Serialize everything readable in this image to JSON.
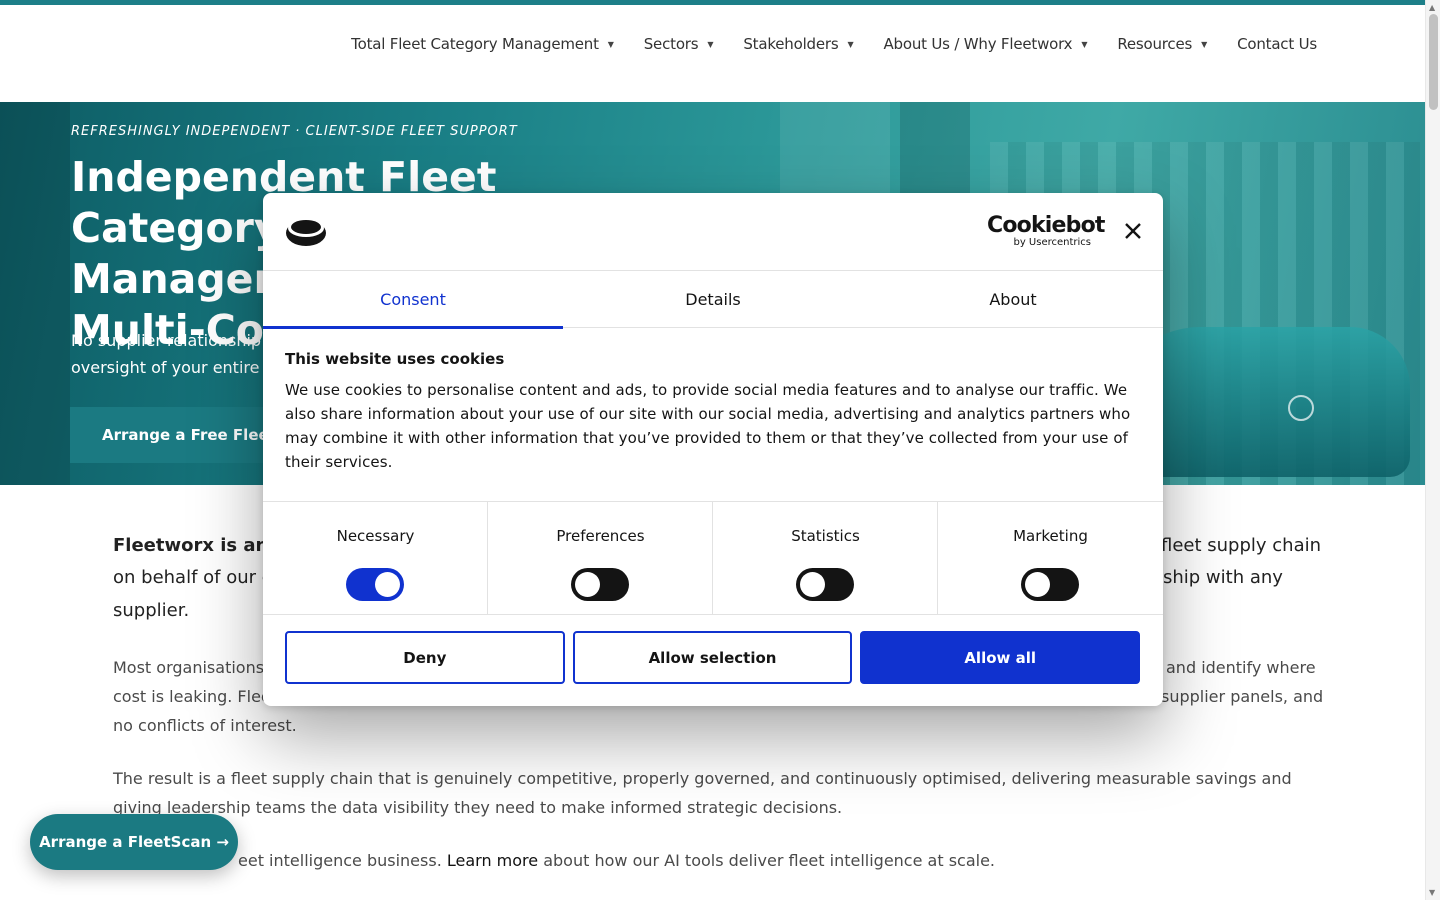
{
  "nav": {
    "items": [
      {
        "label": "Total Fleet Category Management",
        "dropdown": true
      },
      {
        "label": "Sectors",
        "dropdown": true
      },
      {
        "label": "Stakeholders",
        "dropdown": true
      },
      {
        "label": "About Us / Why Fleetworx",
        "dropdown": true
      },
      {
        "label": "Resources",
        "dropdown": true
      },
      {
        "label": "Contact Us",
        "dropdown": false
      }
    ]
  },
  "hero": {
    "eyebrow": "REFRESHINGLY INDEPENDENT · CLIENT-SIDE FLEET SUPPORT",
    "title_line1": "Independent Fleet Category",
    "title_line2": "Managem",
    "title_line3": "Multi-Co",
    "subtitle_line1": "No supplier relationship",
    "subtitle_line2": "oversight of your entire f",
    "cta_label": "Arrange a Free FleetSc"
  },
  "content": {
    "lead_bold": "Fleetworx is an in",
    "lead_right1": "fleet supply chain",
    "lead_line2_left": "on behalf of our c",
    "lead_line2_right": "ship with any",
    "lead_line3": "supplier.",
    "para1_left1": "Most organisations",
    "para1_right1": "and identify where",
    "para1_left2": "cost is leaking. Fleet",
    "para1_right2": "supplier panels, and",
    "para1_line3": "no conflicts of interest.",
    "para2": "The result is a fleet supply chain that is genuinely competitive, properly governed, and continuously optimised, delivering measurable savings and giving leadership teams the data visibility they need to make informed strategic decisions.",
    "para3_pre": "eet intelligence business.",
    "para3_link": "Learn more",
    "para3_post": "about how our AI tools deliver fleet intelligence at scale."
  },
  "fab": {
    "label": "Arrange a FleetScan →"
  },
  "cookie_dialog": {
    "brand": {
      "name": "Cookiebot",
      "byline": "by Usercentrics"
    },
    "tabs": [
      {
        "label": "Consent",
        "active": true
      },
      {
        "label": "Details",
        "active": false
      },
      {
        "label": "About",
        "active": false
      }
    ],
    "title": "This website uses cookies",
    "text": "We use cookies to personalise content and ads, to provide social media features and to analyse our traffic. We also share information about your use of our site with our social media, advertising and analytics partners who may combine it with other information that you’ve provided to them or that they’ve collected from your use of their services.",
    "toggles": [
      {
        "label": "Necessary",
        "on": true
      },
      {
        "label": "Preferences",
        "on": false
      },
      {
        "label": "Statistics",
        "on": false
      },
      {
        "label": "Marketing",
        "on": false
      }
    ],
    "buttons": {
      "deny": "Deny",
      "allow_selection": "Allow selection",
      "allow_all": "Allow all"
    }
  },
  "colors": {
    "accent_blue": "#1032cf",
    "brand_teal": "#1b7a82",
    "top_bar": "#1d7f88"
  }
}
